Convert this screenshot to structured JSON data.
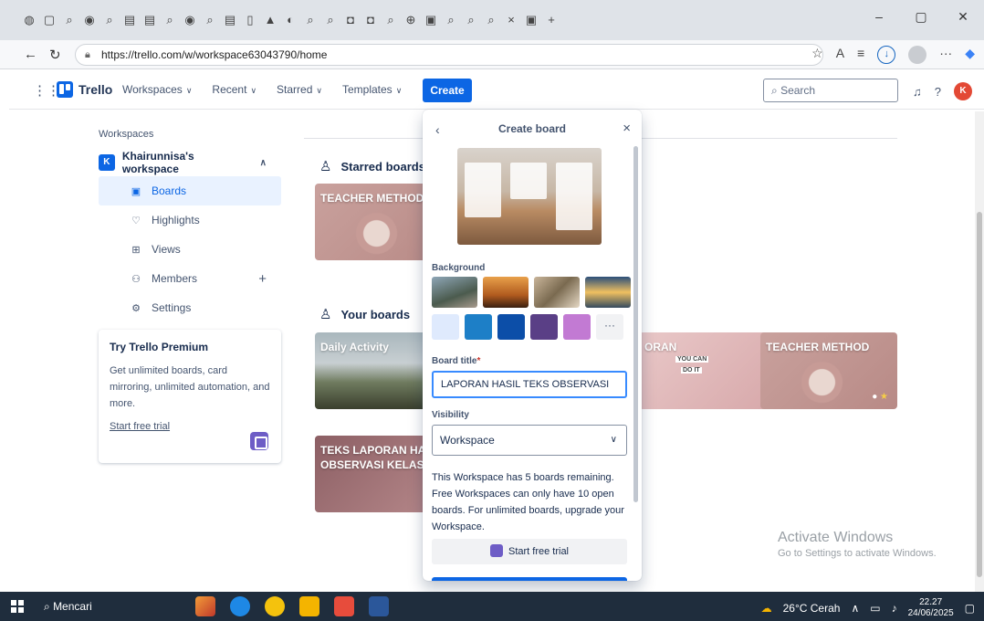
{
  "browser": {
    "url": "https://trello.com/w/workspace63043790/home",
    "tab_close": "×",
    "new_tab": "+"
  },
  "header": {
    "app_name": "Trello",
    "nav": [
      {
        "label": "Workspaces"
      },
      {
        "label": "Recent"
      },
      {
        "label": "Starred"
      },
      {
        "label": "Templates"
      }
    ],
    "create_label": "Create",
    "search_placeholder": "Search",
    "avatar_initial": "K"
  },
  "sidebar": {
    "section_title": "Workspaces",
    "workspace_badge": "K",
    "workspace_name": "Khairunnisa's workspace",
    "items": [
      {
        "label": "Boards",
        "icon": "boards-icon"
      },
      {
        "label": "Highlights",
        "icon": "heart-icon"
      },
      {
        "label": "Views",
        "icon": "views-icon"
      },
      {
        "label": "Members",
        "icon": "members-icon"
      },
      {
        "label": "Settings",
        "icon": "gear-icon"
      }
    ],
    "premium": {
      "title": "Try Trello Premium",
      "description": "Get unlimited boards, card mirroring, unlimited automation, and more.",
      "link": "Start free trial"
    }
  },
  "main": {
    "starred_title": "Starred boards",
    "your_title": "Your boards",
    "starred_boards": [
      {
        "title": "TEACHER METHOD"
      }
    ],
    "your_boards": [
      {
        "title": "Daily Activity"
      },
      {
        "title": "ORAN"
      },
      {
        "title": "TEACHER METHOD"
      },
      {
        "title": "TEKS LAPORAN HA OBSERVASI KELAS."
      }
    ],
    "lap_board_words": [
      "YOU CAN",
      "DO IT"
    ]
  },
  "modal": {
    "title": "Create board",
    "background_label": "Background",
    "more_label": "···",
    "board_title_label": "Board title",
    "required_mark": "*",
    "board_title_value": "LAPORAN HASIL TEKS OBSERVASI",
    "visibility_label": "Visibility",
    "visibility_value": "Workspace",
    "info": "This Workspace has 5 boards remaining. Free Workspaces can only have 10 open boards. For unlimited boards, upgrade your Workspace.",
    "trial_label": "Start free trial",
    "swatch_colors": [
      "#dfeafd",
      "#1d7fc7",
      "#0c4ea8",
      "#5a3f86",
      "#c27ad3"
    ]
  },
  "watermark": {
    "line1": "Activate Windows",
    "line2": "Go to Settings to activate Windows."
  },
  "taskbar": {
    "search_label": "Mencari",
    "weather": "26°C Cerah",
    "time": "22.27",
    "date": "24/06/2025"
  }
}
